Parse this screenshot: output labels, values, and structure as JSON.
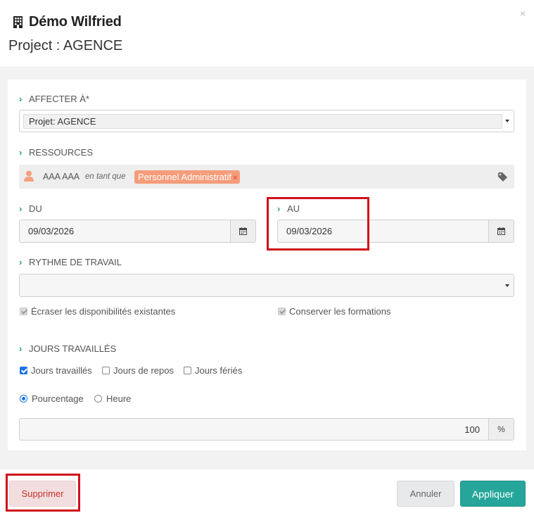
{
  "header": {
    "company": "Démo Wilfried",
    "project_line": "Project : AGENCE",
    "close_symbol": "×",
    "building_icon": "building-icon"
  },
  "form": {
    "assign_to": {
      "label": "AFFECTER À*",
      "selected": "Projet: AGENCE"
    },
    "resources": {
      "label": "RESSOURCES",
      "person_name": "AAA AAA",
      "as_text": "en tant que",
      "role": "Personnel Administratif",
      "remove_symbol": "×"
    },
    "from": {
      "label": "DU",
      "value": "09/03/2026"
    },
    "to": {
      "label": "AU",
      "value": "09/03/2026"
    },
    "work_rhythm": {
      "label": "RYTHME DE TRAVAIL",
      "selected": ""
    },
    "overwrite_availability": {
      "label": "Écraser les disponibilités existantes",
      "checked": true,
      "disabled": true
    },
    "keep_trainings": {
      "label": "Conserver les formations",
      "checked": true,
      "disabled": true
    },
    "worked_days": {
      "label": "JOURS TRAVAILLÉS",
      "options": [
        {
          "label": "Jours travaillés",
          "checked": true
        },
        {
          "label": "Jours de repos",
          "checked": false
        },
        {
          "label": "Jours fériés",
          "checked": false
        }
      ]
    },
    "mode": {
      "options": [
        {
          "label": "Pourcentage",
          "selected": true
        },
        {
          "label": "Heure",
          "selected": false
        }
      ]
    },
    "percentage": {
      "value": "100",
      "unit": "%"
    }
  },
  "footer": {
    "delete_label": "Supprimer",
    "cancel_label": "Annuler",
    "apply_label": "Appliquer"
  },
  "colors": {
    "accent": "#26a69a",
    "chevron": "#2a9d8f",
    "role_badge": "#f59c7a",
    "highlight": "#d0121b",
    "delete_text": "#c9302c"
  }
}
